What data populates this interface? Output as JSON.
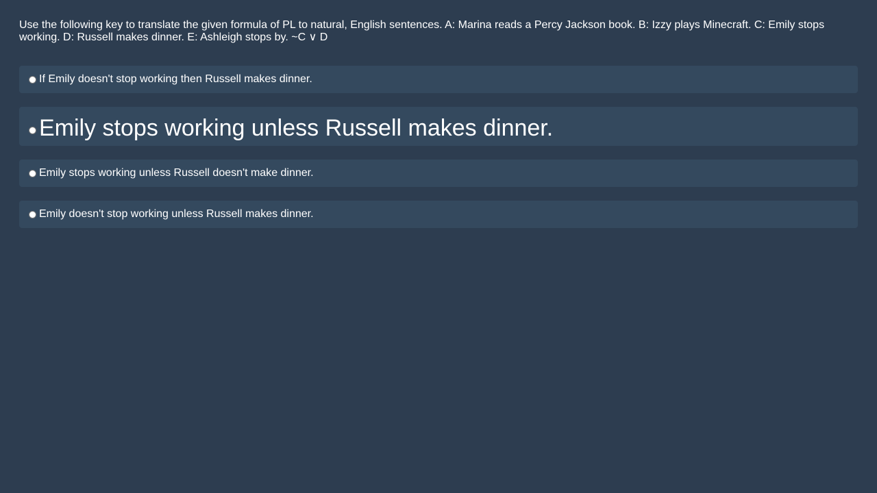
{
  "question": {
    "text": "Use the following key to translate the given formula of PL to natural, English sentences. A: Marina reads a Percy Jackson book. B: Izzy plays Minecraft. C: Emily stops working. D: Russell makes dinner. E: Ashleigh stops by. ~C ∨ D"
  },
  "options": [
    {
      "label": "If Emily doesn't stop working then Russell makes dinner.",
      "selected": false
    },
    {
      "label": "Emily stops working unless Russell makes dinner.",
      "selected": false
    },
    {
      "label": "Emily stops working unless Russell doesn't make dinner.",
      "selected": false
    },
    {
      "label": "Emily doesn't stop working unless Russell makes dinner.",
      "selected": false
    }
  ],
  "colors": {
    "background": "#2d3d50",
    "option_background": "#34495e",
    "text": "#ffffff"
  }
}
